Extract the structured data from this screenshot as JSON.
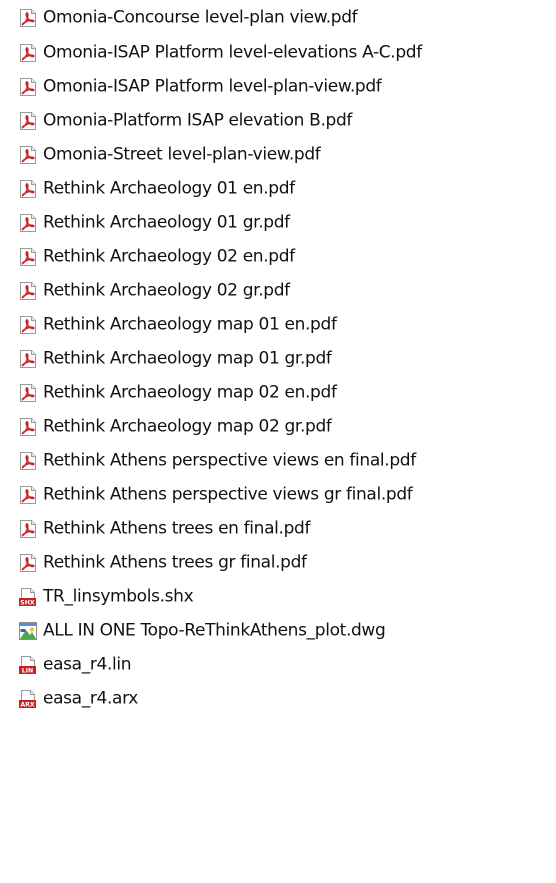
{
  "colors": {
    "text": "#111111",
    "pdf_red": "#c8201e",
    "background": "#ffffff"
  },
  "files": [
    {
      "name": "Omonia-Concourse level-plan view.pdf",
      "icon": "pdf-file-icon"
    },
    {
      "name": "Omonia-ISAP Platform level-elevations A-C.pdf",
      "icon": "pdf-file-icon"
    },
    {
      "name": "Omonia-ISAP Platform level-plan-view.pdf",
      "icon": "pdf-file-icon"
    },
    {
      "name": "Omonia-Platform ISAP elevation B.pdf",
      "icon": "pdf-file-icon"
    },
    {
      "name": "Omonia-Street level-plan-view.pdf",
      "icon": "pdf-file-icon"
    },
    {
      "name": "Rethink Archaeology 01 en.pdf",
      "icon": "pdf-file-icon"
    },
    {
      "name": "Rethink Archaeology 01 gr.pdf",
      "icon": "pdf-file-icon"
    },
    {
      "name": "Rethink Archaeology 02 en.pdf",
      "icon": "pdf-file-icon"
    },
    {
      "name": "Rethink Archaeology 02 gr.pdf",
      "icon": "pdf-file-icon"
    },
    {
      "name": "Rethink Archaeology map 01 en.pdf",
      "icon": "pdf-file-icon"
    },
    {
      "name": "Rethink Archaeology map 01 gr.pdf",
      "icon": "pdf-file-icon"
    },
    {
      "name": "Rethink Archaeology map 02 en.pdf",
      "icon": "pdf-file-icon"
    },
    {
      "name": "Rethink Archaeology map 02 gr.pdf",
      "icon": "pdf-file-icon"
    },
    {
      "name": "Rethink Athens perspective views en final.pdf",
      "icon": "pdf-file-icon"
    },
    {
      "name": "Rethink Athens perspective views gr final.pdf",
      "icon": "pdf-file-icon"
    },
    {
      "name": "Rethink Athens trees en final.pdf",
      "icon": "pdf-file-icon"
    },
    {
      "name": "Rethink Athens trees gr final.pdf",
      "icon": "pdf-file-icon"
    },
    {
      "name": "TR_linsymbols.shx",
      "icon": "shx-file-icon",
      "badge": "SHX"
    },
    {
      "name": "ALL IN ONE Topo-ReThinkAthens_plot.dwg",
      "icon": "dwg-file-icon"
    },
    {
      "name": "easa_r4.lin",
      "icon": "lin-file-icon",
      "badge": "LIN"
    },
    {
      "name": "easa_r4.arx",
      "icon": "arx-file-icon",
      "badge": "ARX"
    }
  ]
}
